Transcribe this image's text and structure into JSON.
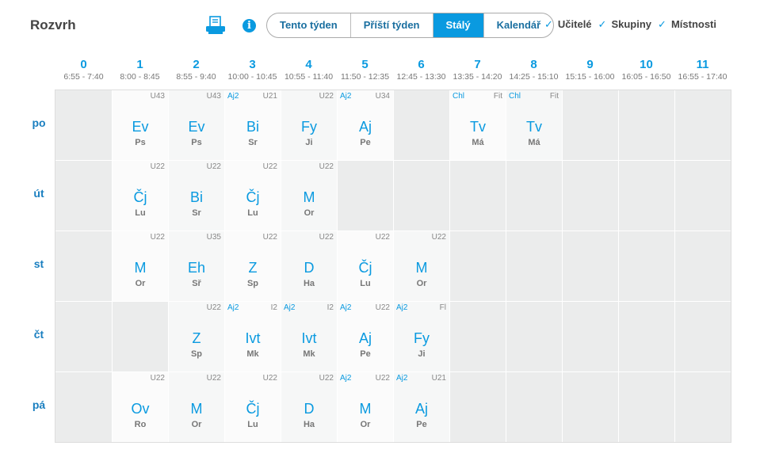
{
  "header": {
    "title": "Rozvrh",
    "print_icon": "printer-icon",
    "info_icon": "info-icon",
    "segments": [
      {
        "label": "Tento týden",
        "active": false
      },
      {
        "label": "Příští týden",
        "active": false
      },
      {
        "label": "Stálý",
        "active": true
      },
      {
        "label": "Kalendář",
        "active": false
      }
    ],
    "toggles": [
      {
        "label": "Učitelé",
        "checked": true
      },
      {
        "label": "Skupiny",
        "checked": true
      },
      {
        "label": "Místnosti",
        "checked": true
      }
    ],
    "accent_color": "#0a9ae0"
  },
  "periods": [
    {
      "num": "0",
      "time": "6:55 - 7:40"
    },
    {
      "num": "1",
      "time": "8:00 - 8:45"
    },
    {
      "num": "2",
      "time": "8:55 - 9:40"
    },
    {
      "num": "3",
      "time": "10:00 - 10:45"
    },
    {
      "num": "4",
      "time": "10:55 - 11:40"
    },
    {
      "num": "5",
      "time": "11:50 - 12:35"
    },
    {
      "num": "6",
      "time": "12:45 - 13:30"
    },
    {
      "num": "7",
      "time": "13:35 - 14:20"
    },
    {
      "num": "8",
      "time": "14:25 - 15:10"
    },
    {
      "num": "9",
      "time": "15:15 - 16:00"
    },
    {
      "num": "10",
      "time": "16:05 - 16:50"
    },
    {
      "num": "11",
      "time": "16:55 - 17:40"
    }
  ],
  "days": [
    {
      "label": "po",
      "cells": [
        null,
        {
          "subject": "Ev",
          "teacher": "Ps",
          "room": "U43"
        },
        {
          "subject": "Ev",
          "teacher": "Ps",
          "room": "U43"
        },
        {
          "subject": "Bi",
          "teacher": "Sr",
          "room": "U21",
          "group": "Aj2"
        },
        {
          "subject": "Fy",
          "teacher": "Ji",
          "room": "U22"
        },
        {
          "subject": "Aj",
          "teacher": "Pe",
          "room": "U34",
          "group": "Aj2"
        },
        null,
        {
          "subject": "Tv",
          "teacher": "Má",
          "room": "Fit",
          "group": "Chl"
        },
        {
          "subject": "Tv",
          "teacher": "Má",
          "room": "Fit",
          "group": "Chl"
        },
        null,
        null,
        null
      ]
    },
    {
      "label": "út",
      "cells": [
        null,
        {
          "subject": "Čj",
          "teacher": "Lu",
          "room": "U22"
        },
        {
          "subject": "Bi",
          "teacher": "Sr",
          "room": "U22"
        },
        {
          "subject": "Čj",
          "teacher": "Lu",
          "room": "U22"
        },
        {
          "subject": "M",
          "teacher": "Or",
          "room": "U22"
        },
        null,
        null,
        null,
        null,
        null,
        null,
        null
      ]
    },
    {
      "label": "st",
      "cells": [
        null,
        {
          "subject": "M",
          "teacher": "Or",
          "room": "U22"
        },
        {
          "subject": "Eh",
          "teacher": "Sř",
          "room": "U35"
        },
        {
          "subject": "Z",
          "teacher": "Sp",
          "room": "U22"
        },
        {
          "subject": "D",
          "teacher": "Ha",
          "room": "U22"
        },
        {
          "subject": "Čj",
          "teacher": "Lu",
          "room": "U22"
        },
        {
          "subject": "M",
          "teacher": "Or",
          "room": "U22"
        },
        null,
        null,
        null,
        null,
        null
      ]
    },
    {
      "label": "čt",
      "cells": [
        null,
        null,
        {
          "subject": "Z",
          "teacher": "Sp",
          "room": "U22"
        },
        {
          "subject": "Ivt",
          "teacher": "Mk",
          "room": "I2",
          "group": "Aj2"
        },
        {
          "subject": "Ivt",
          "teacher": "Mk",
          "room": "I2",
          "group": "Aj2"
        },
        {
          "subject": "Aj",
          "teacher": "Pe",
          "room": "U22",
          "group": "Aj2"
        },
        {
          "subject": "Fy",
          "teacher": "Ji",
          "room": "Fl",
          "group": "Aj2"
        },
        null,
        null,
        null,
        null,
        null
      ]
    },
    {
      "label": "pá",
      "cells": [
        null,
        {
          "subject": "Ov",
          "teacher": "Ro",
          "room": "U22"
        },
        {
          "subject": "M",
          "teacher": "Or",
          "room": "U22"
        },
        {
          "subject": "Čj",
          "teacher": "Lu",
          "room": "U22"
        },
        {
          "subject": "D",
          "teacher": "Ha",
          "room": "U22"
        },
        {
          "subject": "M",
          "teacher": "Or",
          "room": "U22",
          "group": "Aj2"
        },
        {
          "subject": "Aj",
          "teacher": "Pe",
          "room": "U21",
          "group": "Aj2"
        },
        null,
        null,
        null,
        null,
        null
      ]
    }
  ]
}
